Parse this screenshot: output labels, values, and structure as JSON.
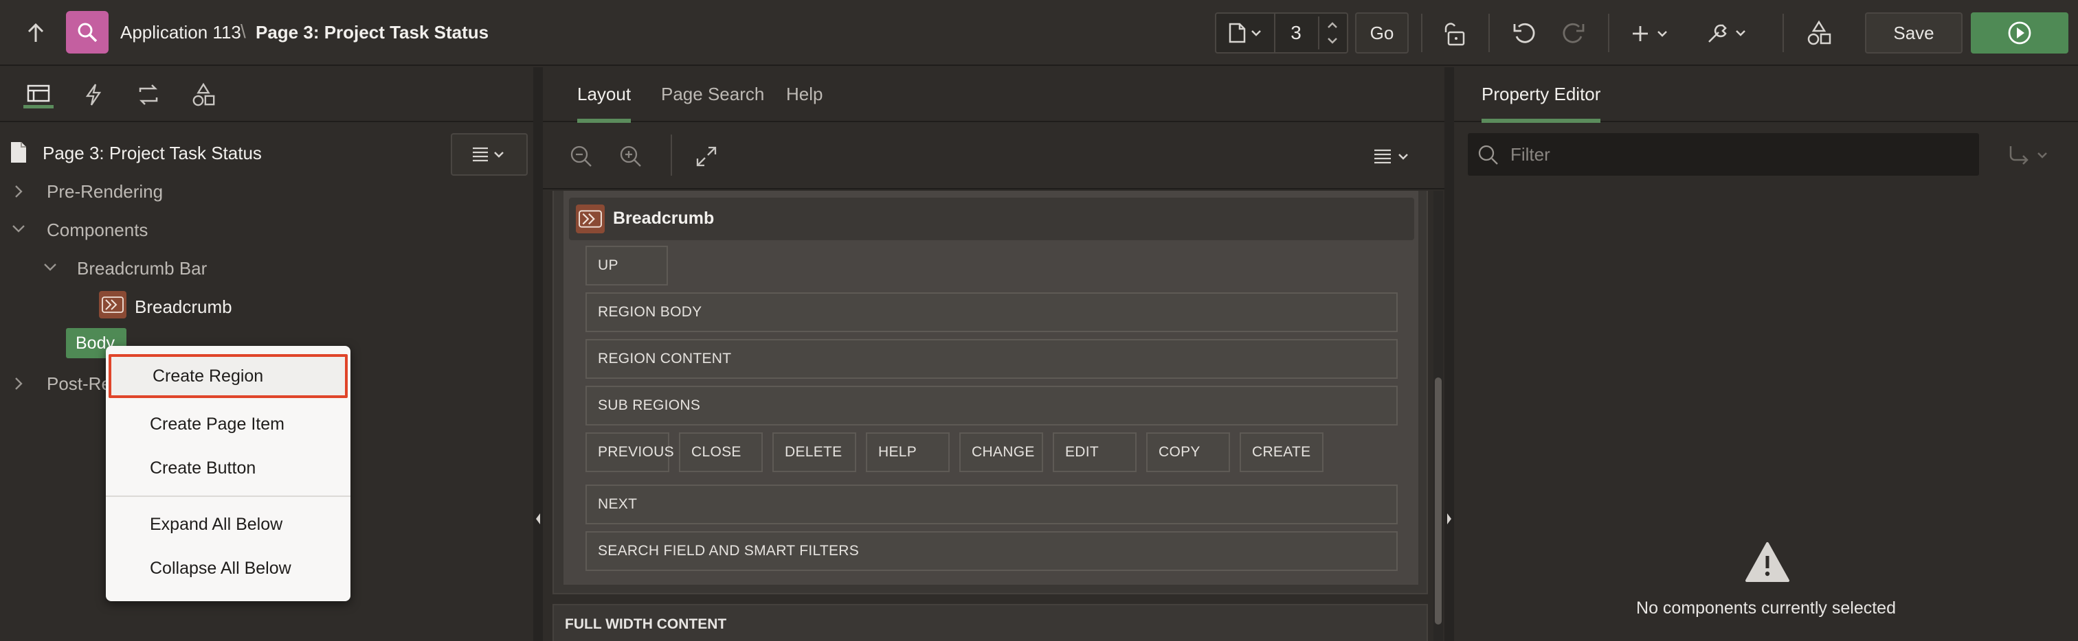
{
  "header": {
    "app_name": "Application 113",
    "separator": "\\",
    "page_title": "Page 3: Project Task Status",
    "page_number": "3",
    "go_label": "Go",
    "save_label": "Save"
  },
  "left_pane": {
    "tabs": [
      "rendering-icon",
      "dynamic-actions-icon",
      "processing-icon",
      "shared-components-icon"
    ],
    "root": "Page 3: Project Task Status",
    "tree": {
      "pre_rendering": "Pre-Rendering",
      "components": "Components",
      "breadcrumb_bar": "Breadcrumb Bar",
      "breadcrumb": "Breadcrumb",
      "body": "Body",
      "post_rendering": "Post-Re"
    }
  },
  "context_menu": {
    "items": [
      "Create Region",
      "Create Page Item",
      "Create Button"
    ],
    "items2": [
      "Expand All Below",
      "Collapse All Below"
    ]
  },
  "middle_pane": {
    "tabs": [
      "Layout",
      "Page Search",
      "Help"
    ],
    "breadcrumb_title": "Breadcrumb",
    "positions": {
      "up": "UP",
      "region_body": "REGION BODY",
      "region_content": "REGION CONTENT",
      "sub_regions": "SUB REGIONS",
      "buttons": [
        "PREVIOUS",
        "CLOSE",
        "DELETE",
        "HELP",
        "CHANGE",
        "EDIT",
        "COPY",
        "CREATE"
      ],
      "next": "NEXT",
      "search": "SEARCH FIELD AND SMART FILTERS",
      "full_width": "FULL WIDTH CONTENT"
    }
  },
  "right_pane": {
    "tab": "Property Editor",
    "filter_placeholder": "Filter",
    "empty_message": "No components currently selected"
  },
  "colors": {
    "accent_green": "#5b8c5c",
    "app_icon": "#c45fa0",
    "highlight_red": "#e0452a"
  }
}
